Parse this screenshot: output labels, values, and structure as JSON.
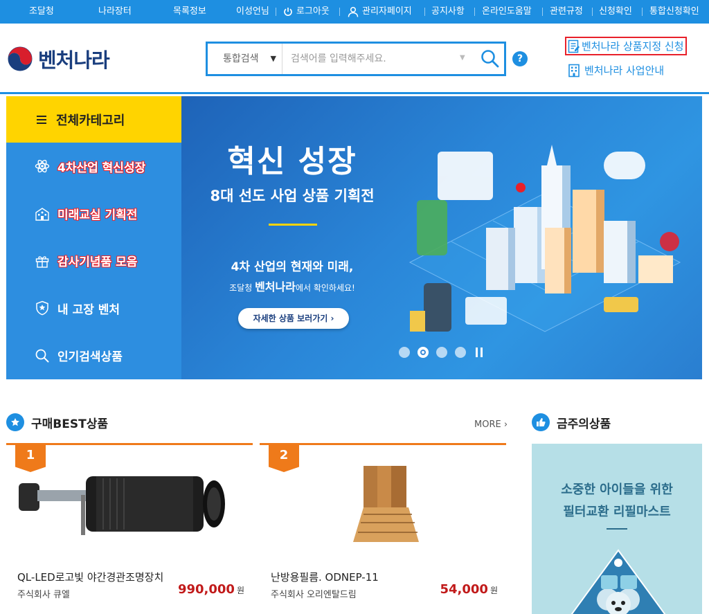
{
  "topbar": {
    "items": [
      "조달청",
      "나라장터",
      "목록정보",
      "이성언님",
      "로그아웃",
      "관리자페이지",
      "공지사항",
      "온라인도움말",
      "관련규정",
      "신청확인",
      "통합신청확인"
    ]
  },
  "header": {
    "logo_text": "벤처나라",
    "search": {
      "selected_option": "통합검색",
      "placeholder": "검색어를 입력해주세요."
    },
    "help_label": "?",
    "link_apply": "벤처나라 상품지정 신청",
    "link_info": "벤처나라 사업안내"
  },
  "category_menu": {
    "title": "전체카테고리",
    "items": [
      {
        "label": "4차산업 혁신성장",
        "icon": "atom-icon"
      },
      {
        "label": "미래교실 기획전",
        "icon": "school-icon"
      },
      {
        "label": "감사기념품 모음",
        "icon": "gift-icon"
      },
      {
        "label": "내 고장 벤처",
        "icon": "shield-star-icon"
      },
      {
        "label": "인기검색상품",
        "icon": "search-icon"
      }
    ]
  },
  "banner": {
    "title": "혁신 성장",
    "subtitle": "8대 선도 사업 상품 기획전",
    "line1": "4차 산업의 현재와 미래,",
    "line2_prefix": "조달청 ",
    "line2_brand": "벤처나라",
    "line2_suffix": "에서 확인하세요!",
    "button_label": "자세한 상품 보러가기  ›",
    "dots_count": 4,
    "active_dot": 2
  },
  "best": {
    "title": "구매BEST상품",
    "more_label": "MORE ›",
    "products": [
      {
        "rank": "1",
        "name": "QL-LED로고빛 야간경관조명장치",
        "company": "주식회사 큐엘",
        "price": "990,000",
        "unit": "원"
      },
      {
        "rank": "2",
        "name": "난방용필름. ODNEP-11",
        "company": "주식회사 오리엔탈드림",
        "price": "54,000",
        "unit": "원"
      }
    ]
  },
  "featured": {
    "title": "금주의상품",
    "line1": "소중한 아이들을 위한",
    "line2": "필터교환 리필마스트"
  },
  "colors": {
    "brand_blue": "#1e8fe1",
    "menu_yellow": "#ffd400",
    "rank_orange": "#ef7a1a",
    "price_red": "#c11a1a",
    "highlight_red": "#e8202a"
  }
}
